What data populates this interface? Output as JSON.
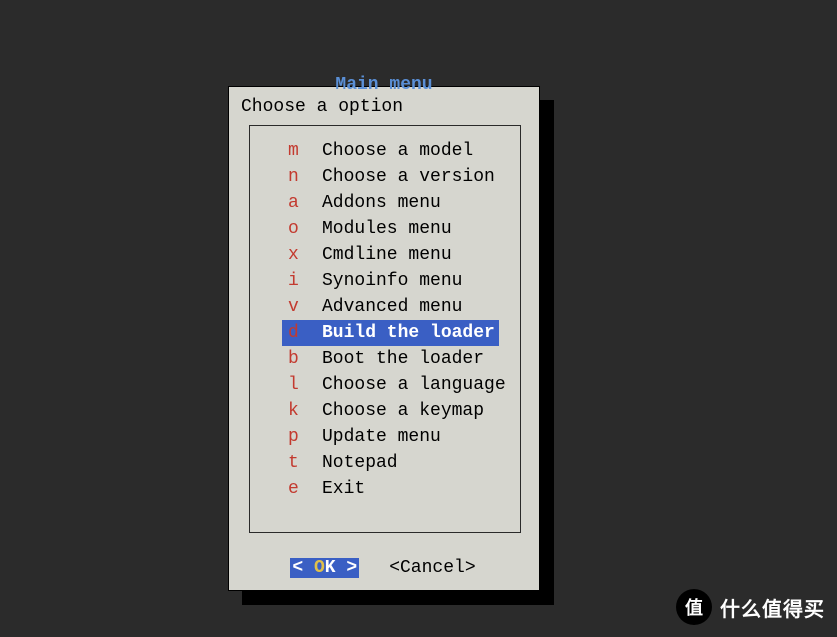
{
  "dialog": {
    "title": "Main menu",
    "prompt": "Choose a option",
    "selected_index": 7,
    "items": [
      {
        "key": "m",
        "label": "Choose a model"
      },
      {
        "key": "n",
        "label": "Choose a version"
      },
      {
        "key": "a",
        "label": "Addons menu"
      },
      {
        "key": "o",
        "label": "Modules menu"
      },
      {
        "key": "x",
        "label": "Cmdline menu"
      },
      {
        "key": "i",
        "label": "Synoinfo menu"
      },
      {
        "key": "v",
        "label": "Advanced menu"
      },
      {
        "key": "d",
        "label": "Build the loader"
      },
      {
        "key": "b",
        "label": "Boot the loader"
      },
      {
        "key": "l",
        "label": "Choose a language"
      },
      {
        "key": "k",
        "label": "Choose a keymap"
      },
      {
        "key": "p",
        "label": "Update menu"
      },
      {
        "key": "t",
        "label": "Notepad"
      },
      {
        "key": "e",
        "label": "Exit"
      }
    ],
    "buttons": {
      "ok": {
        "bracket_l": "<  ",
        "hot": "O",
        "rest": "K  >",
        "focused": true
      },
      "cancel": {
        "text": "<Cancel>",
        "focused": false
      }
    }
  },
  "watermark": {
    "badge": "值",
    "text": "什么值得买"
  }
}
